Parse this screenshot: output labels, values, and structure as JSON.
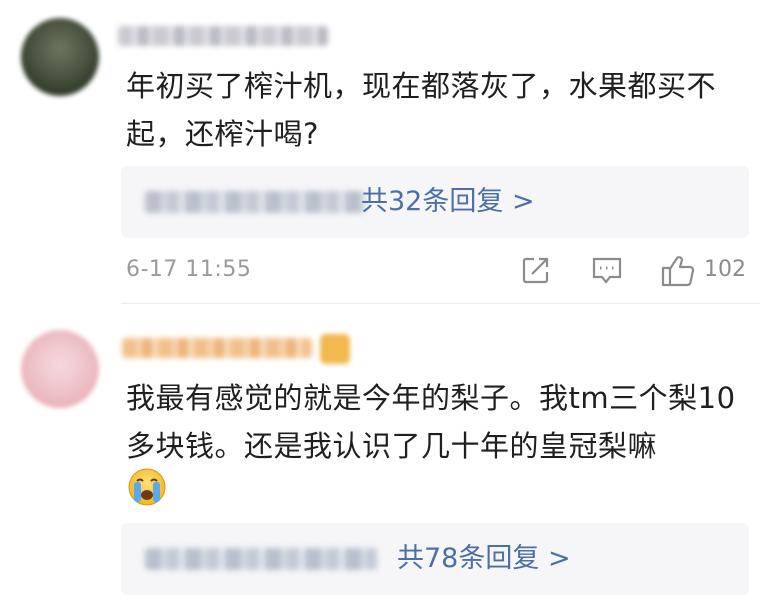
{
  "comments": [
    {
      "text": "年初买了榨汁机，现在都落灰了，水果都买不起，还榨汁喝?",
      "reply_link": "共32条回复 >",
      "time": "6-17 11:55",
      "like_count": "102",
      "icons": [
        "share-icon",
        "comment-icon",
        "thumbs-up-icon"
      ]
    },
    {
      "text": "我最有感觉的就是今年的梨子。我tm三个梨10多块钱。还是我认识了几十年的皇冠梨嘛",
      "emoji": "crying-face-emoji",
      "reply_link": "共78条回复 >"
    }
  ],
  "colors": {
    "link": "#4d6fa8",
    "meta_text": "#9a9a9a",
    "reply_bg": "#f6f6f8"
  }
}
